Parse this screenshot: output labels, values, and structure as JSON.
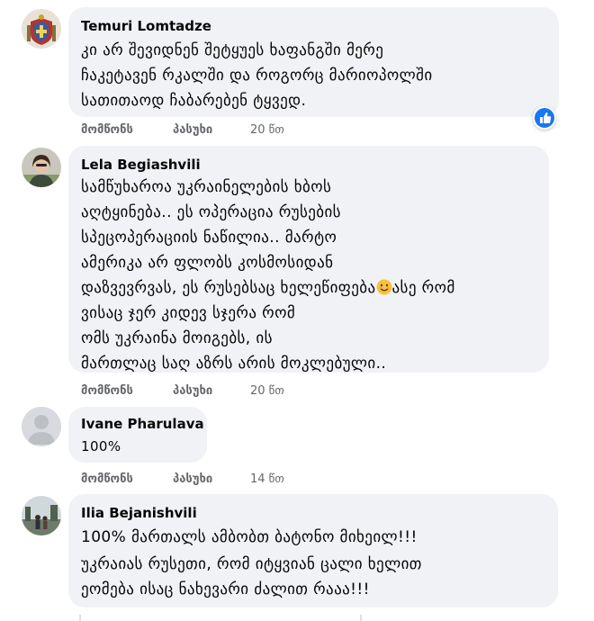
{
  "comments": [
    {
      "author": "Temuri Lomtadze",
      "lines": [
        "კი არ შევიდნენ შეტყუეს ხაფანგში მერე",
        "ჩაკეტავენ რკალში და როგორც მარიოპოლში",
        "სათითაოდ ჩაბარებენ ტყვედ."
      ],
      "like_label": "მომწონს",
      "reply_label": "პასუხი",
      "time": "20 წთ",
      "reaction_icon": "like-icon",
      "avatar_icon": "coat-of-arms-avatar"
    },
    {
      "author": "Lela Begiashvili",
      "lines": [
        "სამწუხაროა უკრაინელების ხბოს",
        "აღტყინება.. ეს ოპერაცია რუსების",
        "სპეცოპერაციის ნაწილია.. მარტო",
        "ამერიკა არ ფლობს კოსმოსიდან",
        "დაზვევრვას, ეს რუსებსაც ხელეწიფება",
        "ვისაც ჯერ კიდევ სჯერა რომ",
        "ომს უკრაინა მოიგებს, ის",
        "მართლაც საღ აზრს არის მოკლებული.."
      ],
      "line5_tail": "ასე რომ",
      "emoji_icon": "smiling-face-emoji",
      "like_label": "მომწონს",
      "reply_label": "პასუხი",
      "time": "20 წთ",
      "avatar_icon": "woman-photo-avatar"
    },
    {
      "author": "Ivane Pharulava",
      "lines": [
        "100%"
      ],
      "like_label": "მომწონს",
      "reply_label": "პასუხი",
      "time": "14 წთ",
      "avatar_icon": "default-person-avatar"
    },
    {
      "author": "Ilia Bejanishvili",
      "lines": [
        "100% მართალს ამბობთ ბატონო მიხეილ!!!",
        "უკრაიას რუსეთი, რომ იტყვიან ცალი ხელით",
        "ეომება ისაც ნახევარი ძალით რააა!!!"
      ],
      "avatar_icon": "outdoor-photo-avatar"
    }
  ],
  "colors": {
    "bubble": "#f0f2f5",
    "text": "#050505",
    "secondary": "#65676b",
    "like_blue": "#1877f2"
  }
}
